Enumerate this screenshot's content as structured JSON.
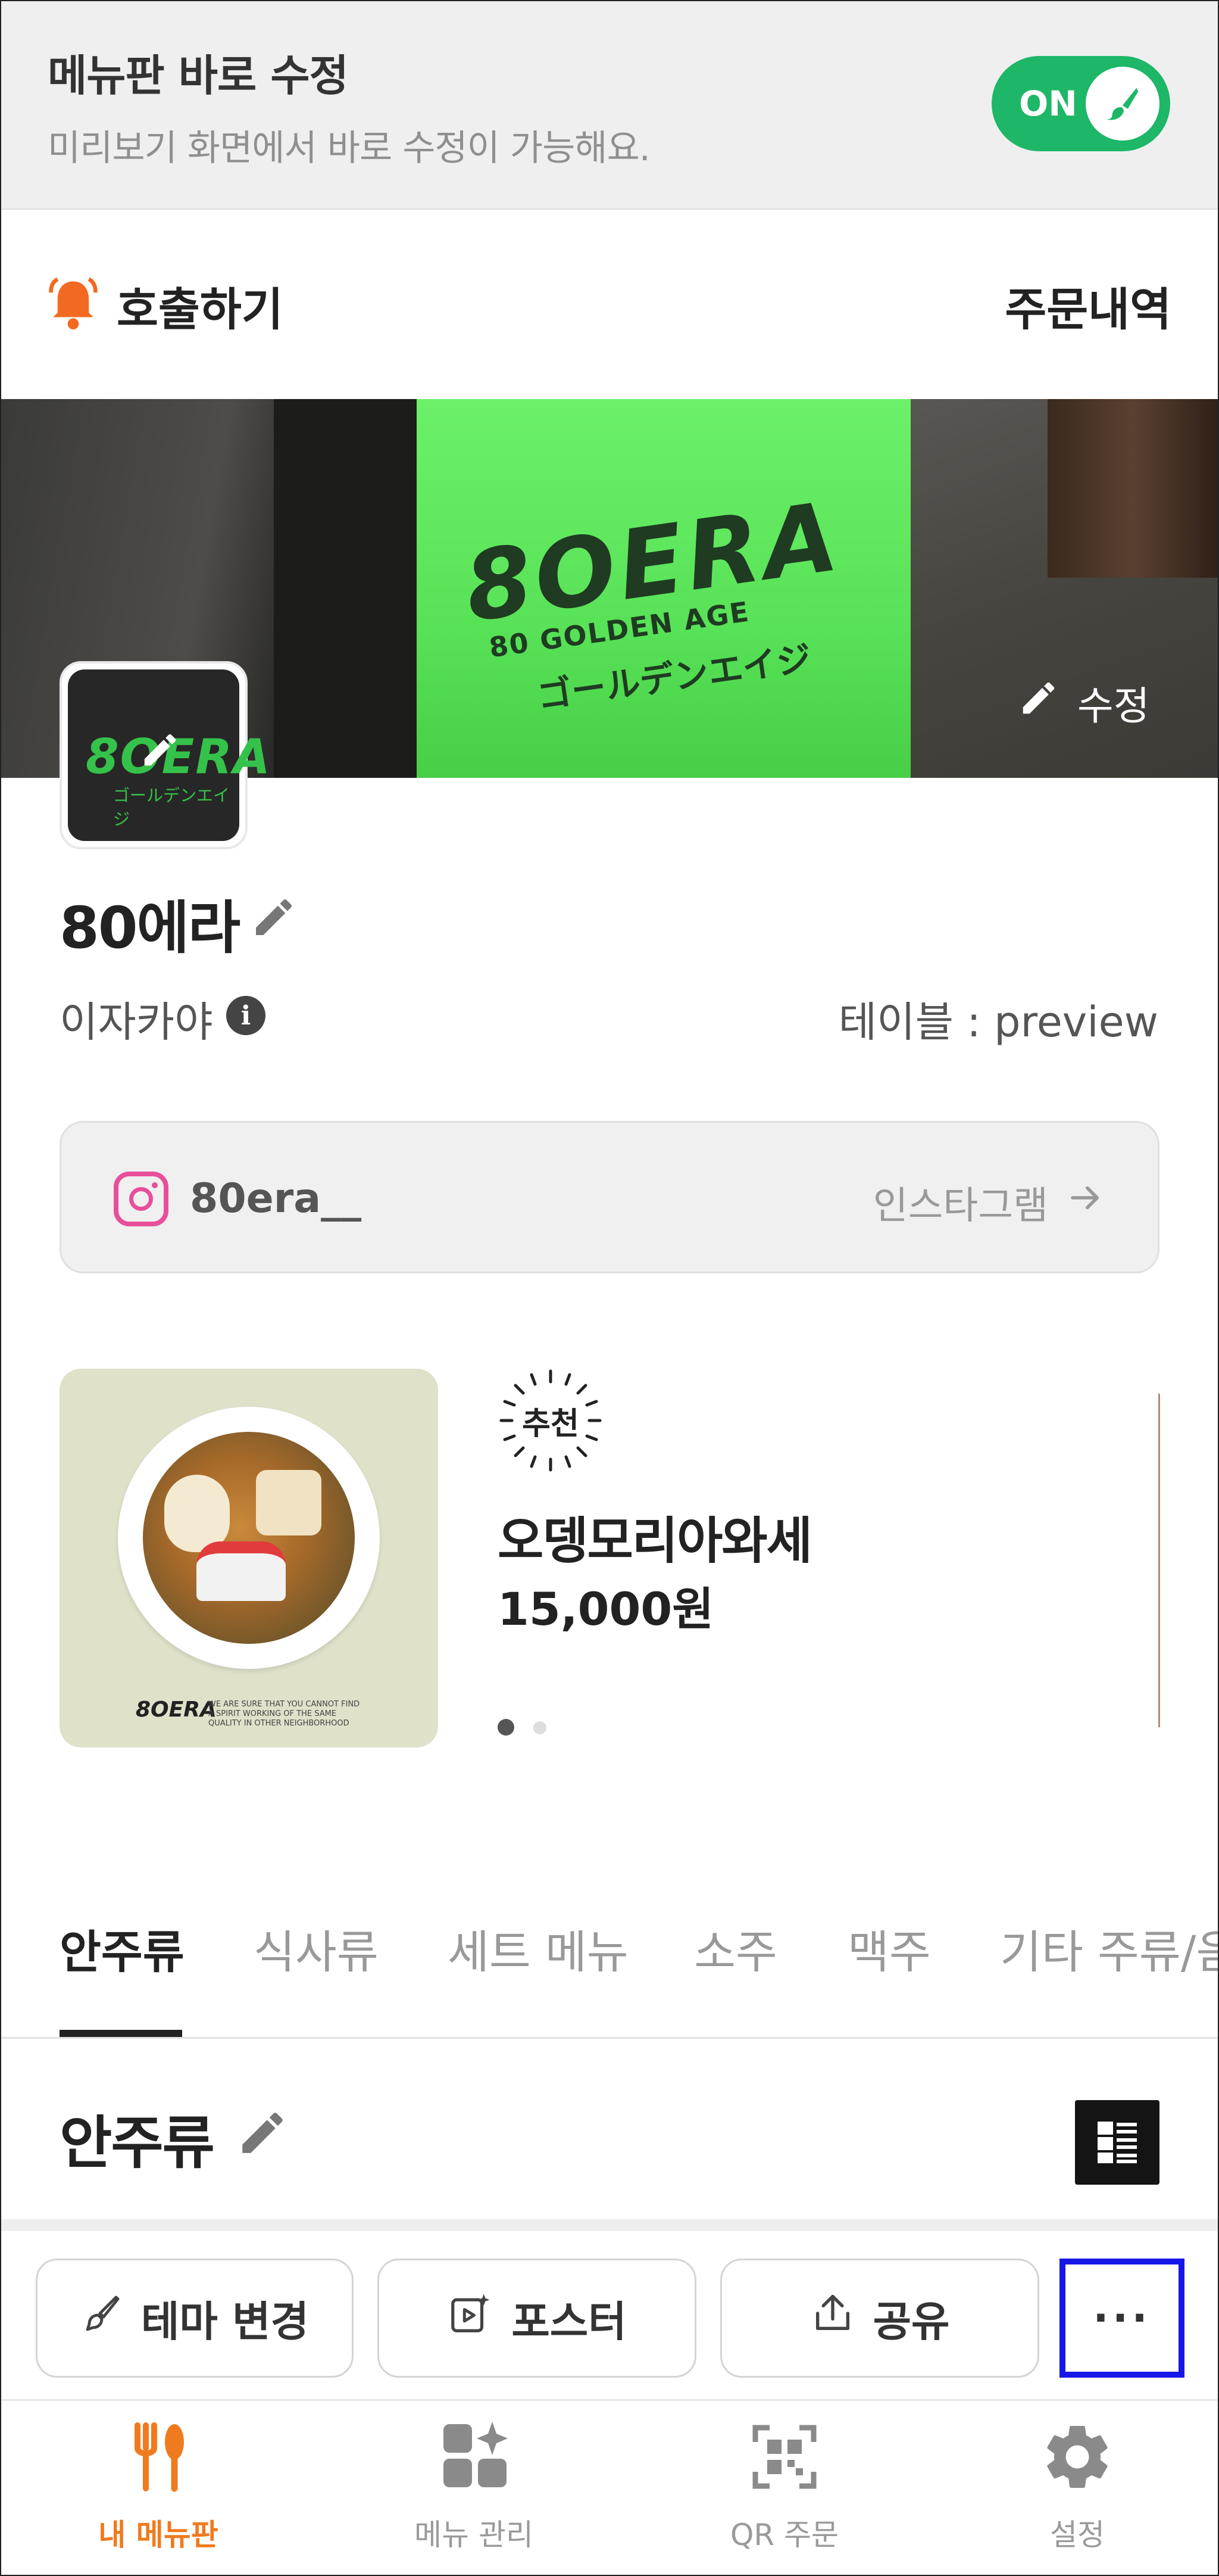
{
  "edit_mode": {
    "title": "메뉴판 바로 수정",
    "subtitle": "미리보기 화면에서 바로 수정이 가능해요.",
    "toggle_label": "ON",
    "accent": "#1db767"
  },
  "header": {
    "call_label": "호출하기",
    "orders_label": "주문내역"
  },
  "cover": {
    "sign_text": "8OERA",
    "sign_sub": "80 GOLDEN AGE",
    "sign_jp": "ゴールデンエイジ",
    "edit_label": "수정"
  },
  "store": {
    "logo_text": "8OERA",
    "logo_sub": "ゴールデンエイジ",
    "name": "80에라",
    "category": "이자카야",
    "info_glyph": "i",
    "table_label": "테이블 : preview"
  },
  "instagram": {
    "handle": "80era__",
    "link_label": "인스타그램",
    "brand_color": "#e84f9a"
  },
  "recommend": {
    "badge": "추천",
    "name": "오뎅모리아와세",
    "price": "15,000원",
    "food_logo": "8OERA",
    "food_fineprint": "WE ARE SURE THAT YOU CANNOT FIND A SPIRIT WORKING OF THE SAME QUALITY IN OTHER NEIGHBORHOOD",
    "page_count": 2,
    "current_page": 1
  },
  "tabs": [
    "안주류",
    "식사류",
    "세트 메뉴",
    "소주",
    "맥주",
    "기타 주류/음"
  ],
  "active_tab": 0,
  "section": {
    "title": "안주류"
  },
  "actions": {
    "theme_label": "테마 변경",
    "poster_label": "포스터",
    "share_label": "공유",
    "more_label": "···"
  },
  "nav": {
    "items": [
      {
        "label": "내 메뉴판",
        "icon": "fork-knife-icon"
      },
      {
        "label": "메뉴 관리",
        "icon": "menu-grid-icon"
      },
      {
        "label": "QR 주문",
        "icon": "qr-icon"
      },
      {
        "label": "설정",
        "icon": "gear-icon"
      }
    ],
    "active_color": "#f07a1e"
  }
}
